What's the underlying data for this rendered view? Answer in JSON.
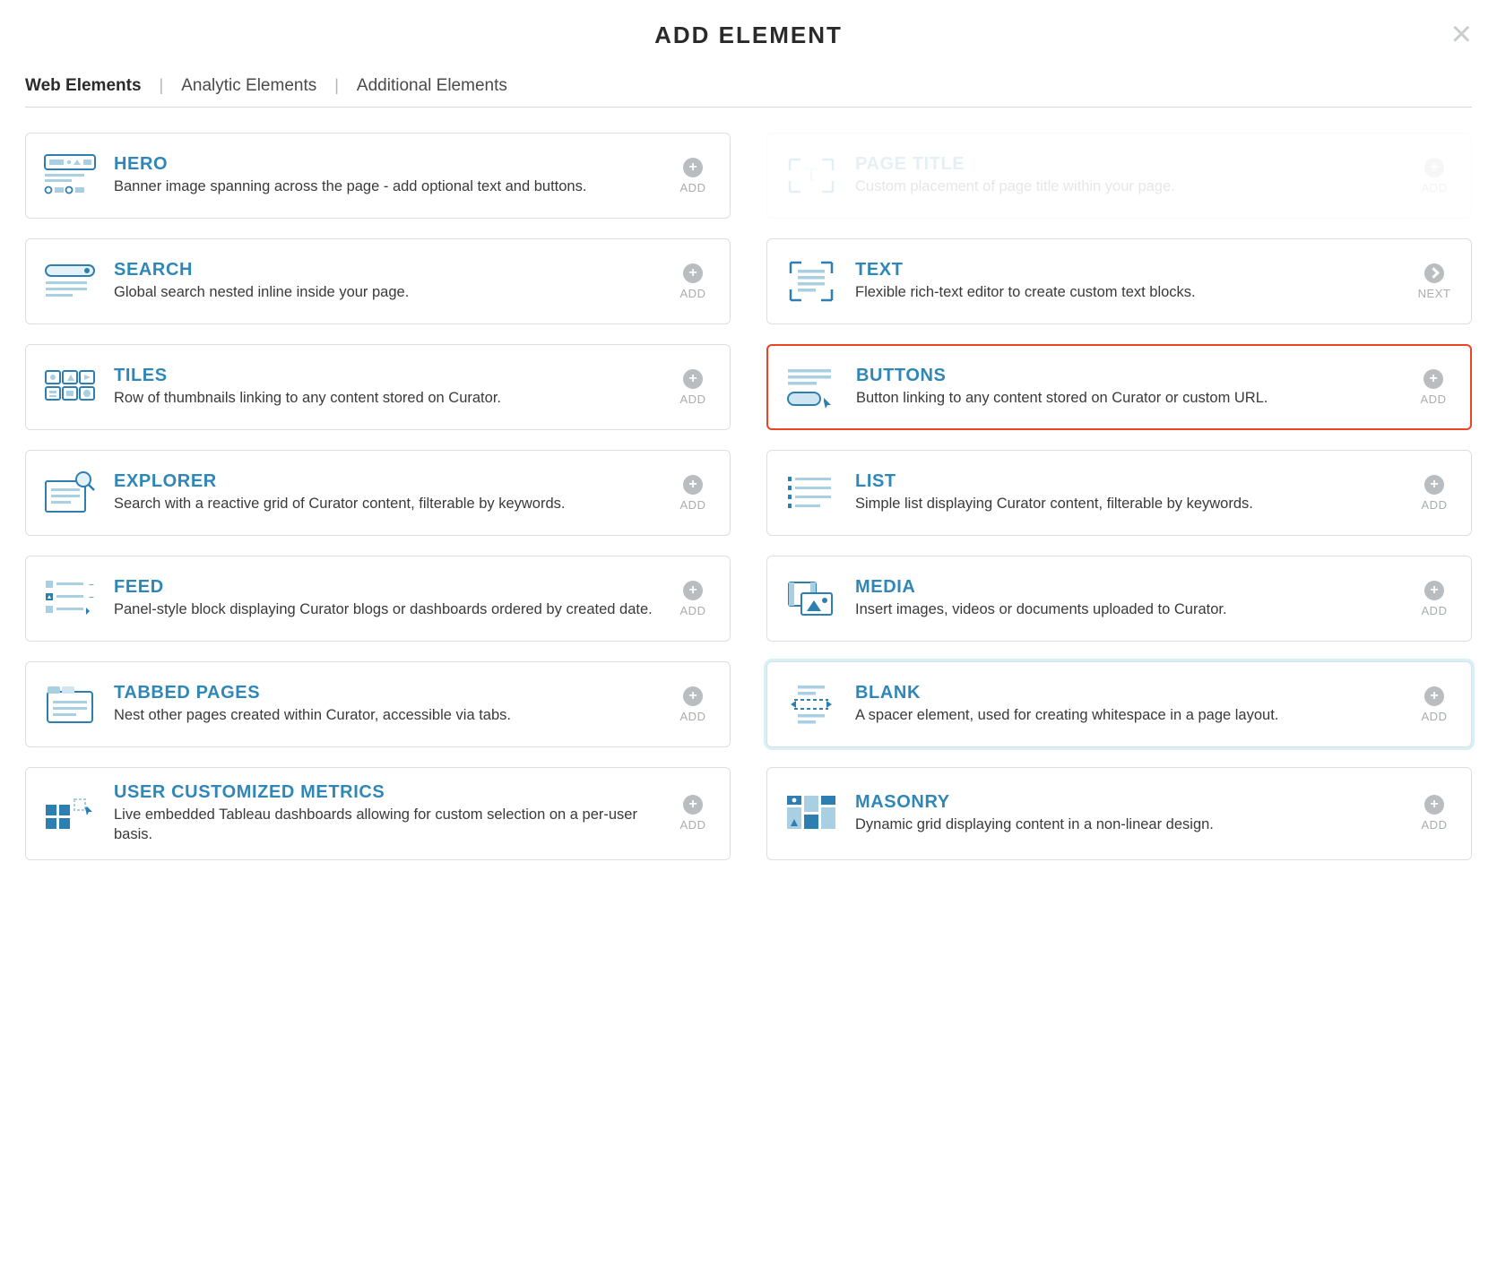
{
  "header": {
    "title": "ADD ELEMENT"
  },
  "tabs": {
    "items": [
      {
        "label": "Web Elements",
        "active": true
      },
      {
        "label": "Analytic Elements",
        "active": false
      },
      {
        "label": "Additional Elements",
        "active": false
      }
    ]
  },
  "actions": {
    "add": "ADD",
    "next": "NEXT"
  },
  "colors": {
    "brand_blue": "#2f87b8",
    "highlight_red": "#ee4325",
    "icon_light": "#a9cfe3",
    "icon_dark": "#2c7fb0",
    "grey": "#b9bdc0"
  },
  "cards": {
    "hero": {
      "title": "HERO",
      "desc": "Banner image spanning across the page - add optional text and buttons.",
      "action": "add",
      "icon": "hero-icon"
    },
    "page_title": {
      "title": "PAGE TITLE",
      "desc": "Custom placement of page title within your page.",
      "action": "add",
      "icon": "page-title-icon",
      "disabled": true
    },
    "search": {
      "title": "SEARCH",
      "desc": "Global search nested inline inside your page.",
      "action": "add",
      "icon": "search-icon"
    },
    "text": {
      "title": "TEXT",
      "desc": "Flexible rich-text editor to create custom text blocks.",
      "action": "next",
      "icon": "text-icon"
    },
    "tiles": {
      "title": "TILES",
      "desc": "Row of thumbnails linking to any content stored on Curator.",
      "action": "add",
      "icon": "tiles-icon"
    },
    "buttons": {
      "title": "BUTTONS",
      "desc": "Button linking to any content stored on Curator or custom URL.",
      "action": "add",
      "icon": "buttons-icon",
      "highlighted": true
    },
    "explorer": {
      "title": "EXPLORER",
      "desc": "Search with a reactive grid of Curator content, filterable by keywords.",
      "action": "add",
      "icon": "explorer-icon"
    },
    "list": {
      "title": "LIST",
      "desc": "Simple list displaying Curator content, filterable by keywords.",
      "action": "add",
      "icon": "list-icon"
    },
    "feed": {
      "title": "FEED",
      "desc": "Panel-style block displaying Curator blogs or dashboards ordered by created date.",
      "action": "add",
      "icon": "feed-icon"
    },
    "media": {
      "title": "MEDIA",
      "desc": "Insert images, videos or documents uploaded to Curator.",
      "action": "add",
      "icon": "media-icon"
    },
    "tabbed_pages": {
      "title": "TABBED PAGES",
      "desc": "Nest other pages created within Curator, accessible via tabs.",
      "action": "add",
      "icon": "tabbed-pages-icon"
    },
    "blank": {
      "title": "BLANK",
      "desc": "A spacer element, used for creating whitespace in a page layout.",
      "action": "add",
      "icon": "blank-icon",
      "glow": true
    },
    "user_customized_metrics": {
      "title": "USER CUSTOMIZED METRICS",
      "desc": "Live embedded Tableau dashboards allowing for custom selection on a per-user basis.",
      "action": "add",
      "icon": "metrics-icon"
    },
    "masonry": {
      "title": "MASONRY",
      "desc": "Dynamic grid displaying content in a non-linear design.",
      "action": "add",
      "icon": "masonry-icon"
    }
  }
}
